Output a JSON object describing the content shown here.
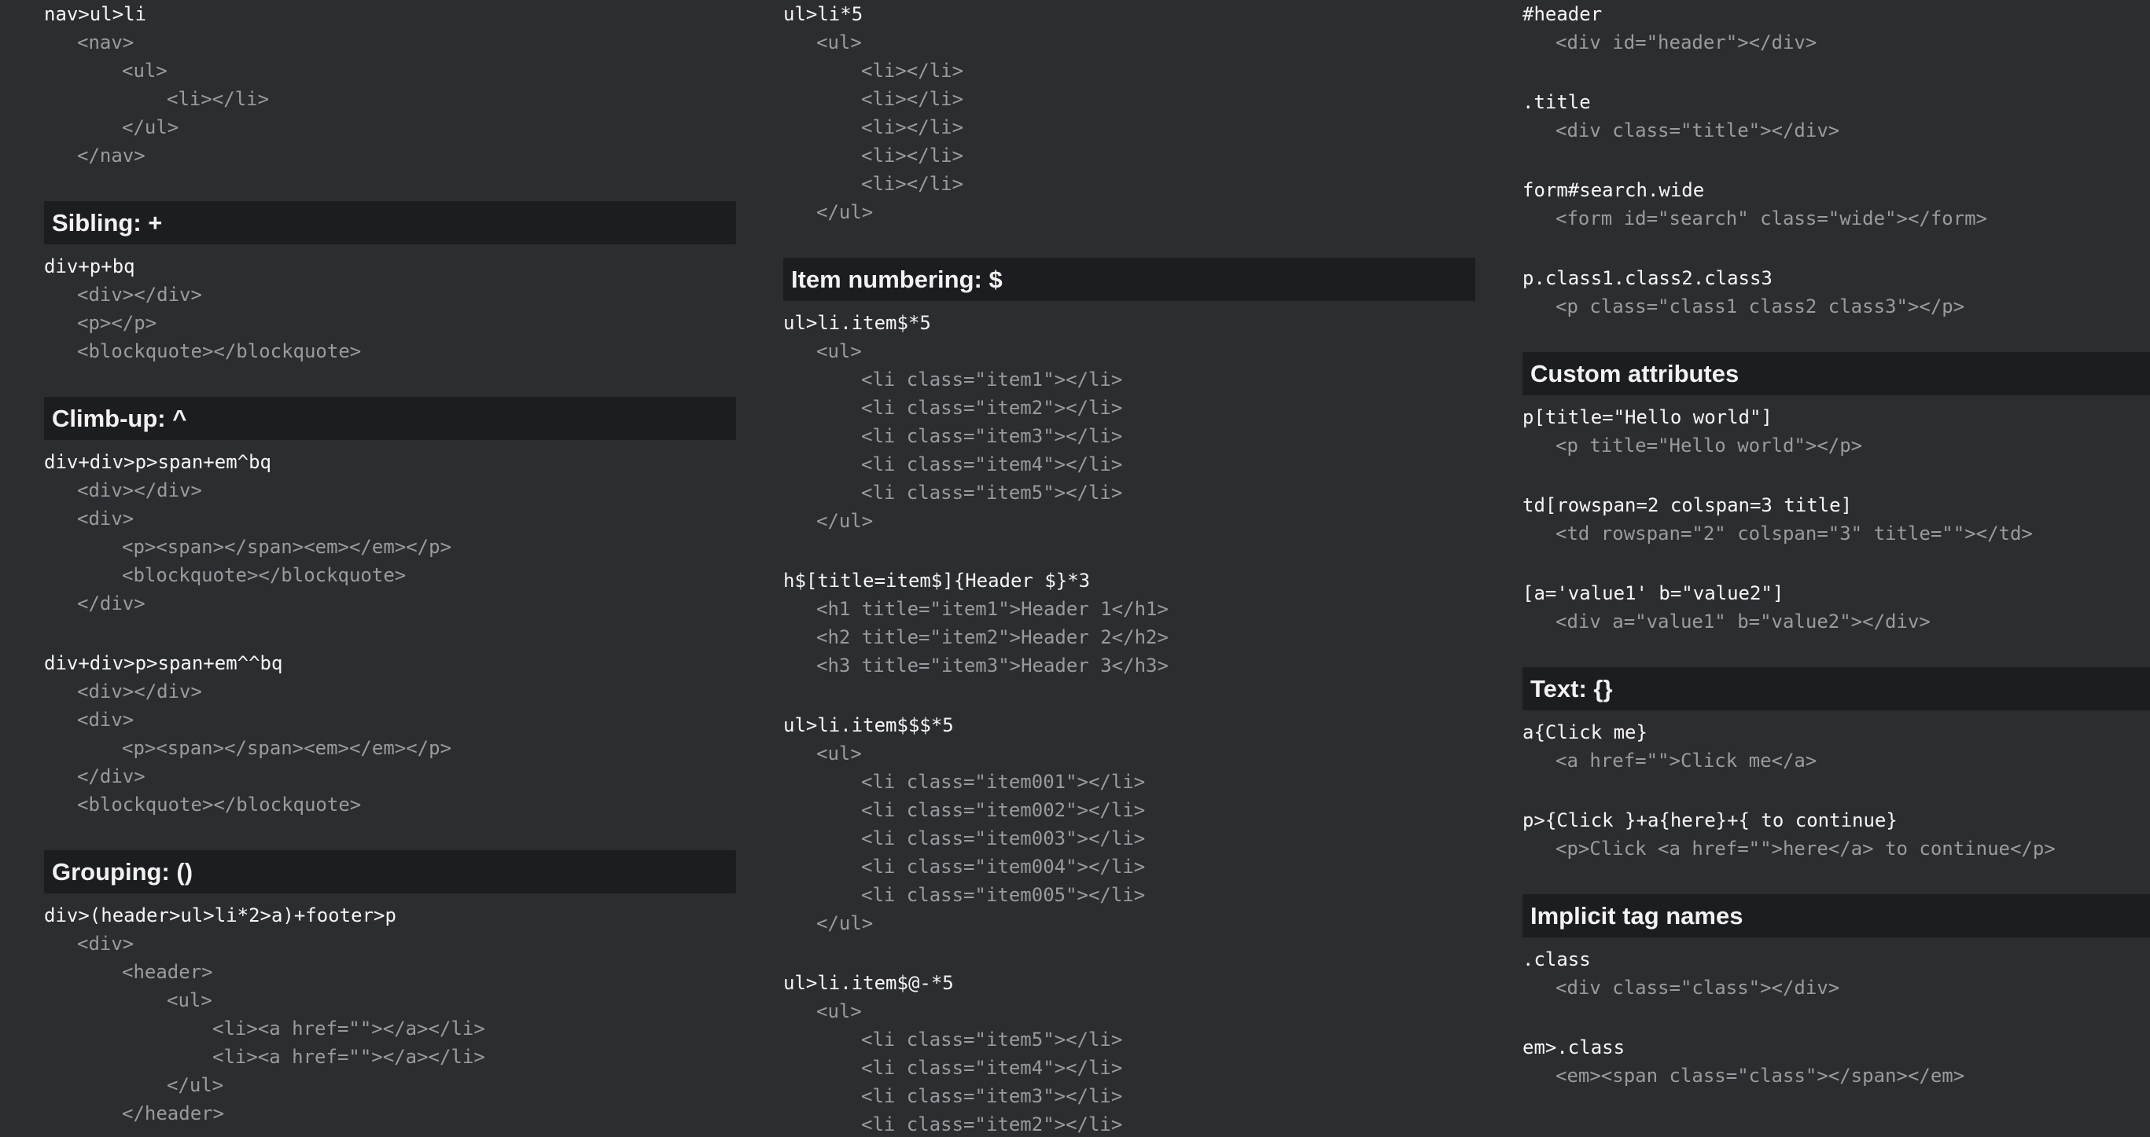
{
  "columns": [
    {
      "sections": [
        {
          "heading": "",
          "examples": [
            {
              "abbr": "nav>ul>li",
              "output": [
                {
                  "indent": 0,
                  "text": "<nav>"
                },
                {
                  "indent": 1,
                  "text": "<ul>"
                },
                {
                  "indent": 2,
                  "text": "<li></li>"
                },
                {
                  "indent": 1,
                  "text": "</ul>"
                },
                {
                  "indent": 0,
                  "text": "</nav>"
                }
              ]
            }
          ]
        },
        {
          "heading": "Sibling: +",
          "examples": [
            {
              "abbr": "div+p+bq",
              "output": [
                {
                  "indent": 0,
                  "text": "<div></div>"
                },
                {
                  "indent": 0,
                  "text": "<p></p>"
                },
                {
                  "indent": 0,
                  "text": "<blockquote></blockquote>"
                }
              ]
            }
          ]
        },
        {
          "heading": "Climb-up: ^",
          "examples": [
            {
              "abbr": "div+div>p>span+em^bq",
              "output": [
                {
                  "indent": 0,
                  "text": "<div></div>"
                },
                {
                  "indent": 0,
                  "text": "<div>"
                },
                {
                  "indent": 1,
                  "text": "<p><span></span><em></em></p>"
                },
                {
                  "indent": 1,
                  "text": "<blockquote></blockquote>"
                },
                {
                  "indent": 0,
                  "text": "</div>"
                }
              ]
            },
            {
              "abbr": "div+div>p>span+em^^bq",
              "output": [
                {
                  "indent": 0,
                  "text": "<div></div>"
                },
                {
                  "indent": 0,
                  "text": "<div>"
                },
                {
                  "indent": 1,
                  "text": "<p><span></span><em></em></p>"
                },
                {
                  "indent": 0,
                  "text": "</div>"
                },
                {
                  "indent": 0,
                  "text": "<blockquote></blockquote>"
                }
              ]
            }
          ]
        },
        {
          "heading": "Grouping: ()",
          "examples": [
            {
              "abbr": "div>(header>ul>li*2>a)+footer>p",
              "output": [
                {
                  "indent": 0,
                  "text": "<div>"
                },
                {
                  "indent": 1,
                  "text": "<header>"
                },
                {
                  "indent": 2,
                  "text": "<ul>"
                },
                {
                  "indent": 3,
                  "text": "<li><a href=\"\"></a></li>"
                },
                {
                  "indent": 3,
                  "text": "<li><a href=\"\"></a></li>"
                },
                {
                  "indent": 2,
                  "text": "</ul>"
                },
                {
                  "indent": 1,
                  "text": "</header>"
                }
              ]
            }
          ]
        }
      ]
    },
    {
      "sections": [
        {
          "heading": "",
          "examples": [
            {
              "abbr": "ul>li*5",
              "output": [
                {
                  "indent": 0,
                  "text": "<ul>"
                },
                {
                  "indent": 1,
                  "text": "<li></li>"
                },
                {
                  "indent": 1,
                  "text": "<li></li>"
                },
                {
                  "indent": 1,
                  "text": "<li></li>"
                },
                {
                  "indent": 1,
                  "text": "<li></li>"
                },
                {
                  "indent": 1,
                  "text": "<li></li>"
                },
                {
                  "indent": 0,
                  "text": "</ul>"
                }
              ]
            }
          ]
        },
        {
          "heading": "Item numbering: $",
          "examples": [
            {
              "abbr": "ul>li.item$*5",
              "output": [
                {
                  "indent": 0,
                  "text": "<ul>"
                },
                {
                  "indent": 1,
                  "text": "<li class=\"item1\"></li>"
                },
                {
                  "indent": 1,
                  "text": "<li class=\"item2\"></li>"
                },
                {
                  "indent": 1,
                  "text": "<li class=\"item3\"></li>"
                },
                {
                  "indent": 1,
                  "text": "<li class=\"item4\"></li>"
                },
                {
                  "indent": 1,
                  "text": "<li class=\"item5\"></li>"
                },
                {
                  "indent": 0,
                  "text": "</ul>"
                }
              ]
            },
            {
              "abbr": "h$[title=item$]{Header $}*3",
              "output": [
                {
                  "indent": 0,
                  "text": "<h1 title=\"item1\">Header 1</h1>"
                },
                {
                  "indent": 0,
                  "text": "<h2 title=\"item2\">Header 2</h2>"
                },
                {
                  "indent": 0,
                  "text": "<h3 title=\"item3\">Header 3</h3>"
                }
              ]
            },
            {
              "abbr": "ul>li.item$$$*5",
              "output": [
                {
                  "indent": 0,
                  "text": "<ul>"
                },
                {
                  "indent": 1,
                  "text": "<li class=\"item001\"></li>"
                },
                {
                  "indent": 1,
                  "text": "<li class=\"item002\"></li>"
                },
                {
                  "indent": 1,
                  "text": "<li class=\"item003\"></li>"
                },
                {
                  "indent": 1,
                  "text": "<li class=\"item004\"></li>"
                },
                {
                  "indent": 1,
                  "text": "<li class=\"item005\"></li>"
                },
                {
                  "indent": 0,
                  "text": "</ul>"
                }
              ]
            },
            {
              "abbr": "ul>li.item$@-*5",
              "output": [
                {
                  "indent": 0,
                  "text": "<ul>"
                },
                {
                  "indent": 1,
                  "text": "<li class=\"item5\"></li>"
                },
                {
                  "indent": 1,
                  "text": "<li class=\"item4\"></li>"
                },
                {
                  "indent": 1,
                  "text": "<li class=\"item3\"></li>"
                },
                {
                  "indent": 1,
                  "text": "<li class=\"item2\"></li>"
                }
              ]
            }
          ]
        }
      ]
    },
    {
      "sections": [
        {
          "heading": "",
          "examples": [
            {
              "abbr": "#header",
              "output": [
                {
                  "indent": 0,
                  "text": "<div id=\"header\"></div>"
                }
              ]
            },
            {
              "abbr": ".title",
              "output": [
                {
                  "indent": 0,
                  "text": "<div class=\"title\"></div>"
                }
              ]
            },
            {
              "abbr": "form#search.wide",
              "output": [
                {
                  "indent": 0,
                  "text": "<form id=\"search\" class=\"wide\"></form>"
                }
              ]
            },
            {
              "abbr": "p.class1.class2.class3",
              "output": [
                {
                  "indent": 0,
                  "text": "<p class=\"class1 class2 class3\"></p>"
                }
              ]
            }
          ]
        },
        {
          "heading": "Custom attributes",
          "examples": [
            {
              "abbr": "p[title=\"Hello world\"]",
              "output": [
                {
                  "indent": 0,
                  "text": "<p title=\"Hello world\"></p>"
                }
              ]
            },
            {
              "abbr": "td[rowspan=2 colspan=3 title]",
              "output": [
                {
                  "indent": 0,
                  "text": "<td rowspan=\"2\" colspan=\"3\" title=\"\"></td>"
                }
              ]
            },
            {
              "abbr": "[a='value1' b=\"value2\"]",
              "output": [
                {
                  "indent": 0,
                  "text": "<div a=\"value1\" b=\"value2\"></div>"
                }
              ]
            }
          ]
        },
        {
          "heading": "Text: {}",
          "examples": [
            {
              "abbr": "a{Click me}",
              "output": [
                {
                  "indent": 0,
                  "text": "<a href=\"\">Click me</a>"
                }
              ]
            },
            {
              "abbr": "p>{Click }+a{here}+{ to continue}",
              "output": [
                {
                  "indent": 0,
                  "text": "<p>Click <a href=\"\">here</a> to continue</p>"
                }
              ]
            }
          ]
        },
        {
          "heading": "Implicit tag names",
          "examples": [
            {
              "abbr": ".class",
              "output": [
                {
                  "indent": 0,
                  "text": "<div class=\"class\"></div>"
                }
              ]
            },
            {
              "abbr": "em>.class",
              "output": [
                {
                  "indent": 0,
                  "text": "<em><span class=\"class\"></span></em>"
                }
              ]
            }
          ]
        }
      ]
    }
  ]
}
